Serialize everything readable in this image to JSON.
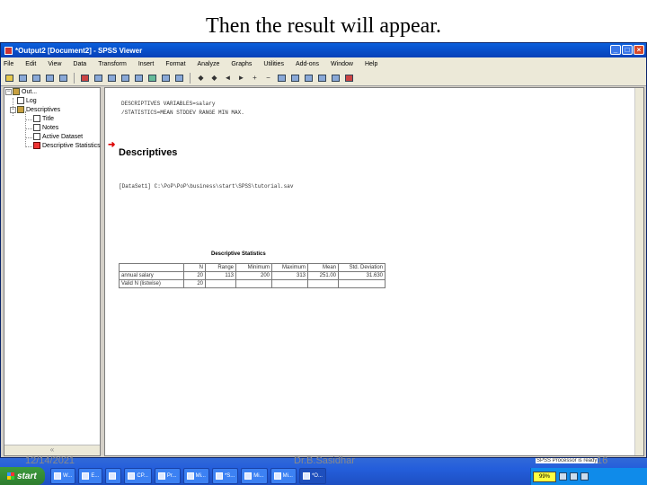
{
  "slide": {
    "title": "Then the result will appear."
  },
  "window": {
    "title": "*Output2 [Document2] - SPSS Viewer"
  },
  "menu": [
    "File",
    "Edit",
    "View",
    "Data",
    "Transform",
    "Insert",
    "Format",
    "Analyze",
    "Graphs",
    "Utilities",
    "Add-ons",
    "Window",
    "Help"
  ],
  "outline": {
    "items": [
      {
        "label": "Out...",
        "icon": "book-icon"
      },
      {
        "label": "Log",
        "icon": "page-icon"
      },
      {
        "label": "Descriptives",
        "icon": "book-icon"
      },
      {
        "label": "Title",
        "icon": "page-icon"
      },
      {
        "label": "Notes",
        "icon": "page-icon"
      },
      {
        "label": "Active Dataset",
        "icon": "page-icon"
      },
      {
        "label": "Descriptive Statistics",
        "icon": "table-icon"
      }
    ],
    "scroll_glyph": "«"
  },
  "content": {
    "syntax_line1": "DESCRIPTIVES VARIABLES=salary",
    "syntax_line2": "/STATISTICS=MEAN STDDEV RANGE MIN MAX.",
    "heading": "Descriptives",
    "dataset_line": "[DataSet1] C:\\PoP\\PoP\\business\\start\\SPSS\\tutorial.sav",
    "table": {
      "title": "Descriptive Statistics",
      "headers": [
        "",
        "N",
        "Range",
        "Minimum",
        "Maximum",
        "Mean",
        "Std. Deviation"
      ],
      "rows": [
        [
          "annual salary",
          "20",
          "113",
          "200",
          "313",
          "251.00",
          "31.630"
        ],
        [
          "Valid N (listwise)",
          "20",
          "",
          "",
          "",
          "",
          ""
        ]
      ]
    }
  },
  "taskbar": {
    "start_label": "start",
    "zoom": "99%",
    "tasks": [
      "W...",
      "E...",
      "",
      "CP...",
      "Pr...",
      "Mi...",
      "*S...",
      "Mi...",
      "Mi...",
      "Mi...",
      "*O..."
    ]
  },
  "footer": {
    "date": "12/14/2021",
    "author": "Dr.B.Sasidhar",
    "processor_status": "SPSS Processor is ready",
    "page": "16"
  },
  "colors": {
    "titlebar": "#0a5fdc",
    "taskbar": "#245edb",
    "start": "#2e7d2e"
  }
}
